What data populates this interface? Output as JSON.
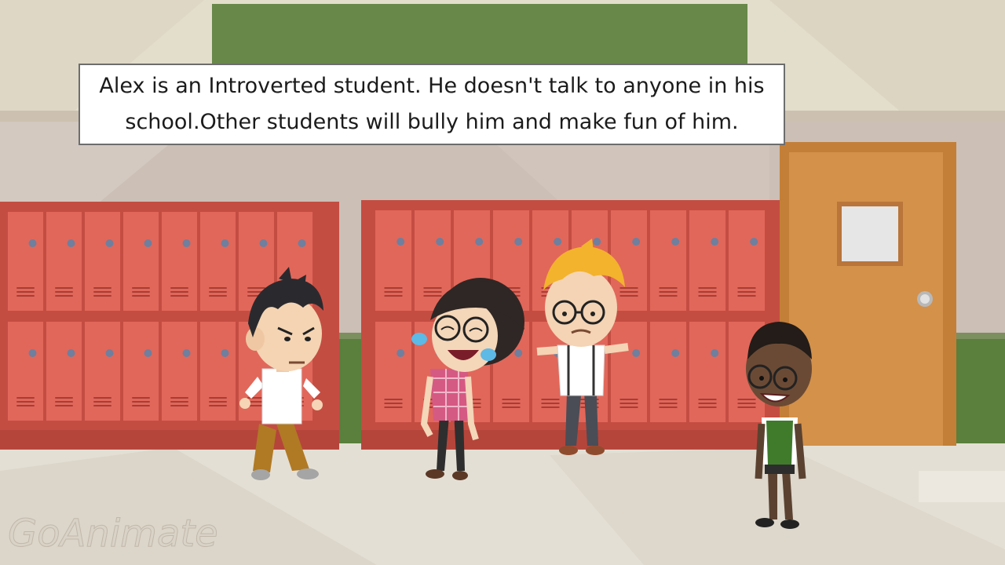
{
  "caption": {
    "text": "Alex is an Introverted student.  He doesn't talk to anyone in his school.Other students will bully him and make fun of him."
  },
  "watermark": {
    "text": "GoAnimate"
  },
  "colors": {
    "wall_upper": "#e2dccb",
    "wall_band": "#cdbfb3",
    "green_board": "#6a8d48",
    "lockers": "#d9554a",
    "door": "#cf8b40",
    "floor": "#e5e0d6"
  },
  "characters": [
    {
      "name": "angry-boy-alex"
    },
    {
      "name": "laughing-girl"
    },
    {
      "name": "shrugging-blond-boy"
    },
    {
      "name": "smiling-boy-green-vest"
    }
  ]
}
